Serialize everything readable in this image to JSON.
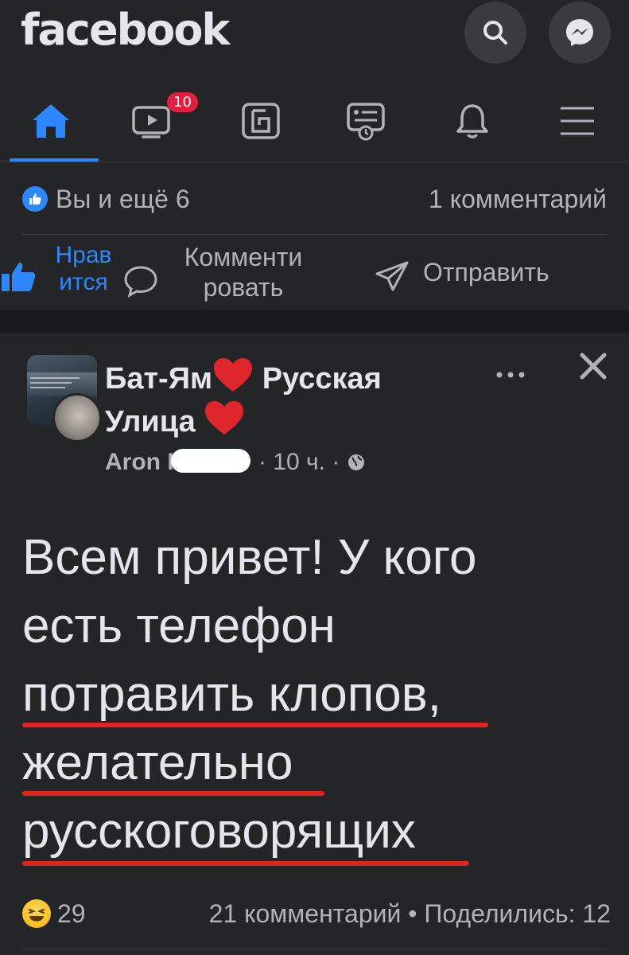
{
  "header": {
    "logo": "facebook"
  },
  "nav": {
    "tabs": [
      {
        "name": "home",
        "icon": "home-icon",
        "active": true
      },
      {
        "name": "watch",
        "icon": "video-icon",
        "badge": "10"
      },
      {
        "name": "pages",
        "icon": "pages-icon"
      },
      {
        "name": "marketplace",
        "icon": "feed-icon"
      },
      {
        "name": "notifications",
        "icon": "bell-icon"
      },
      {
        "name": "menu",
        "icon": "menu-icon"
      }
    ]
  },
  "post1": {
    "reactions": "Вы и ещё 6",
    "comments": "1 комментарий",
    "actions": {
      "like": "Нравится",
      "like_line1": "Нрав",
      "like_line2": "ится",
      "comment_line1": "Комменти",
      "comment_line2": "ровать",
      "share": "Отправить"
    }
  },
  "post2": {
    "group_name_line1": "Бат-Ям",
    "group_name_line2": "Русская",
    "group_name_line3": "Улица",
    "author": "Aron К",
    "time": "· 10 ч. ·",
    "text_lines": [
      "Всем привет! У кого",
      "есть телефон",
      "потравить клопов,",
      "желательно",
      "русскоговорящих"
    ],
    "reaction_count": "29",
    "comments": "21 комментарий",
    "shares": "• Поделились: 12"
  },
  "colors": {
    "background": "#242526",
    "accent": "#2d88ff",
    "underline": "#e52121",
    "badge": "#e41e3f"
  }
}
